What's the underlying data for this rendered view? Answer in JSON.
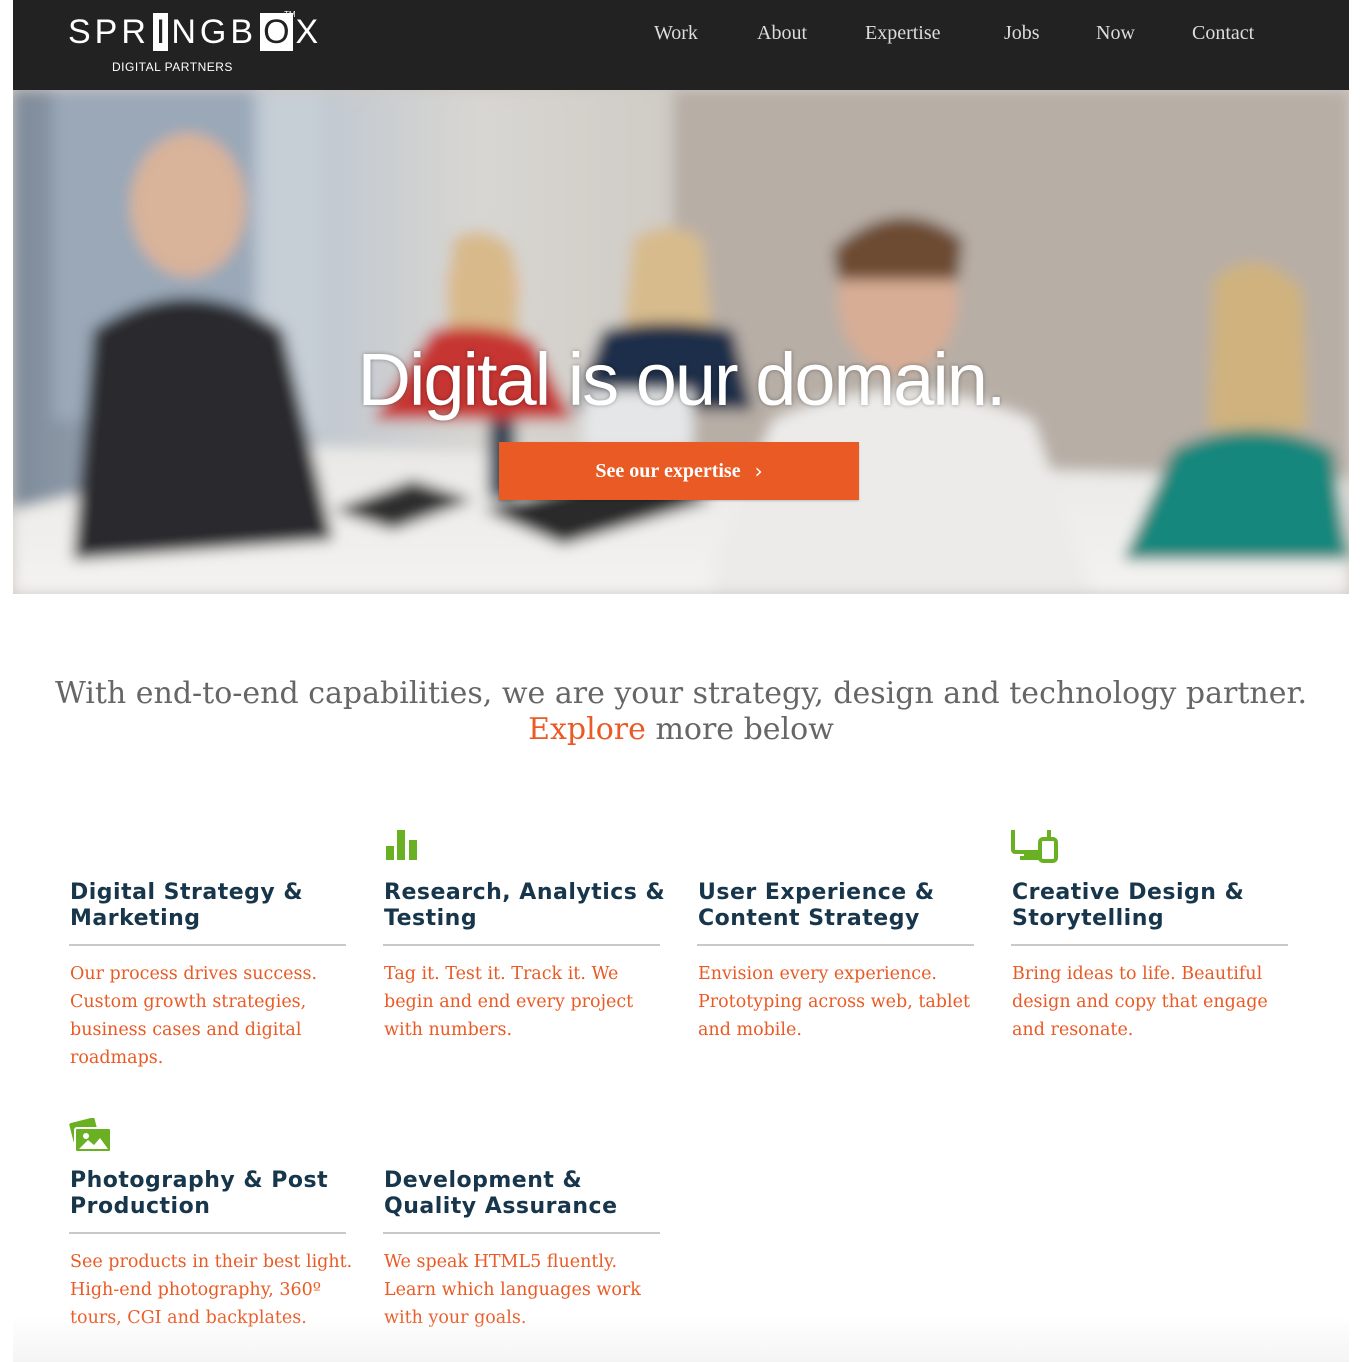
{
  "header": {
    "logo_text_left": "SPR",
    "logo_text_box": "I",
    "logo_text_mid": "NGB",
    "logo_text_box2": "O",
    "logo_text_right": "X",
    "logo_tm": "TM",
    "logo_subtitle": "DIGITAL PARTNERS",
    "nav": [
      {
        "label": "Work"
      },
      {
        "label": "About"
      },
      {
        "label": "Expertise"
      },
      {
        "label": "Jobs"
      },
      {
        "label": "Now"
      },
      {
        "label": "Contact"
      }
    ]
  },
  "hero": {
    "title": "Digital is our domain.",
    "cta_label": "See our expertise",
    "cta_chevron": "›"
  },
  "intro": {
    "text_before": "With end-to-end capabilities, we are your strategy, design and technology partner.",
    "accent": "Explore",
    "text_after": "more below"
  },
  "services": [
    {
      "title": "Digital Strategy & Marketing",
      "description": "Our process drives success. Custom growth strategies, business cases and digital roadmaps.",
      "icon": "none"
    },
    {
      "title": "Research, Analytics & Testing",
      "description": "Tag it. Test it. Track it. We begin and end every project with numbers.",
      "icon": "bar-chart-icon"
    },
    {
      "title": "User Experience & Content Strategy",
      "description": "Envision every experience. Prototyping across web, tablet and mobile.",
      "icon": "none"
    },
    {
      "title": "Creative Design & Storytelling",
      "description": "Bring ideas to life. Beautiful design and copy that engage and resonate.",
      "icon": "devices-icon"
    },
    {
      "title": "Photography & Post Production",
      "description": "See products in their best light. High-end photography, 360º tours, CGI and backplates.",
      "icon": "photos-icon"
    },
    {
      "title": "Development & Quality Assurance",
      "description": "We speak HTML5 fluently. Learn which languages work with your goals.",
      "icon": "none"
    }
  ],
  "colors": {
    "accent_orange": "#ea5a24",
    "heading_navy": "#17364b",
    "icon_green": "#6ab023",
    "header_bg": "#222222"
  }
}
